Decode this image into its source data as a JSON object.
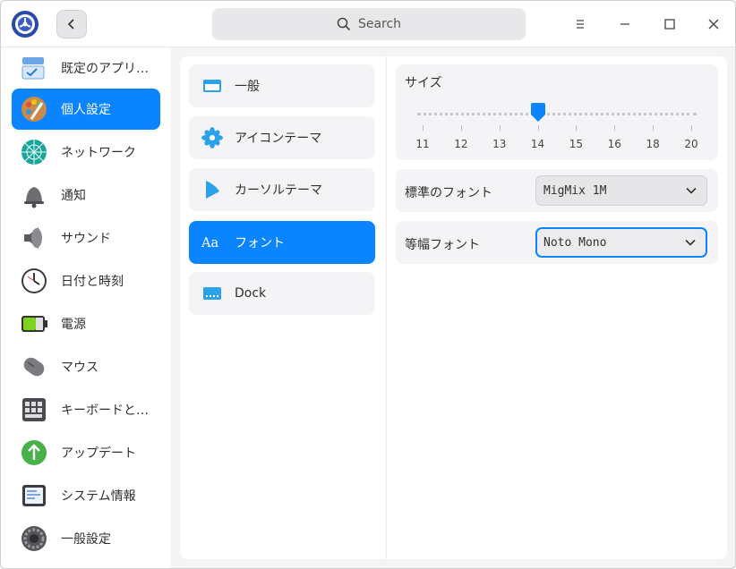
{
  "titlebar": {
    "search_placeholder": "Search"
  },
  "sidebar": {
    "items": [
      {
        "label": "既定のアプリ…",
        "icon": "default-apps-icon"
      },
      {
        "label": "個人設定",
        "icon": "personalization-icon",
        "active": true
      },
      {
        "label": "ネットワーク",
        "icon": "network-icon"
      },
      {
        "label": "通知",
        "icon": "bell-icon"
      },
      {
        "label": "サウンド",
        "icon": "speaker-icon"
      },
      {
        "label": "日付と時刻",
        "icon": "clock-icon"
      },
      {
        "label": "電源",
        "icon": "battery-icon"
      },
      {
        "label": "マウス",
        "icon": "mouse-icon"
      },
      {
        "label": "キーボードと…",
        "icon": "keyboard-icon"
      },
      {
        "label": "アップデート",
        "icon": "update-arrow-icon"
      },
      {
        "label": "システム情報",
        "icon": "system-info-icon"
      },
      {
        "label": "一般設定",
        "icon": "gear-icon"
      }
    ]
  },
  "submenu": {
    "items": [
      {
        "label": "一般",
        "icon": "window-icon"
      },
      {
        "label": "アイコンテーマ",
        "icon": "flower-icon"
      },
      {
        "label": "カーソルテーマ",
        "icon": "cursor-icon"
      },
      {
        "label": "フォント",
        "icon": "font-aa-icon",
        "active": true
      },
      {
        "label": "Dock",
        "icon": "dock-icon"
      }
    ]
  },
  "font_settings": {
    "size_label": "サイズ",
    "size_ticks": [
      "11",
      "12",
      "13",
      "14",
      "15",
      "16",
      "18",
      "20"
    ],
    "size_value": "14",
    "standard_font_label": "標準のフォント",
    "standard_font_value": "MigMix 1M",
    "monospace_font_label": "等幅フォント",
    "monospace_font_value": "Noto Mono"
  },
  "colors": {
    "accent": "#0a84ff",
    "window_bg": "#f4f4f6"
  }
}
